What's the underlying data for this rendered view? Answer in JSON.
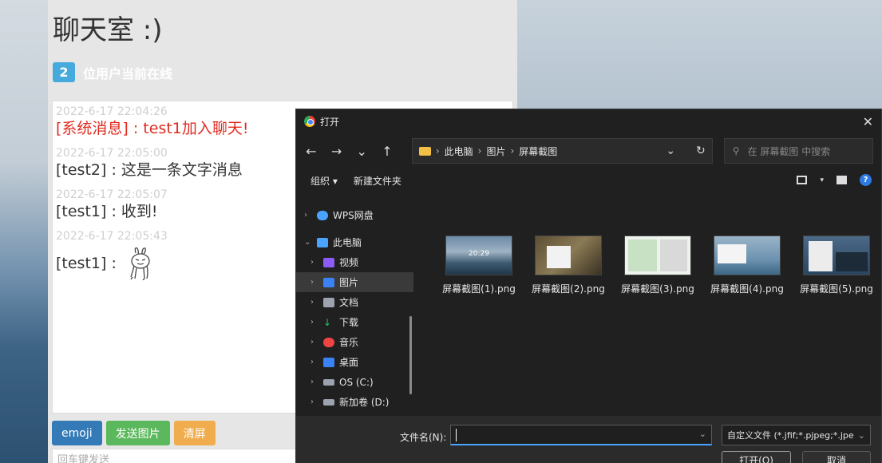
{
  "chat": {
    "title": "聊天室 :)",
    "online_count": "2",
    "online_label": "位用户当前在线",
    "messages": [
      {
        "time": "2022-6-17 22:04:26",
        "text": "[系统消息] : test1加入聊天!"
      },
      {
        "time": "2022-6-17 22:05:00",
        "text": "[test2] : 这是一条文字消息"
      },
      {
        "time": "2022-6-17 22:05:07",
        "text": "[test1] : 收到!"
      },
      {
        "time": "2022-6-17 22:05:43",
        "text": "[test1] :"
      }
    ],
    "buttons": {
      "emoji": "emoji",
      "send_image": "发送图片",
      "clear": "清屏"
    },
    "input_placeholder": "回车键发送",
    "colors": {
      "system": "#e02b20",
      "badge": "#46aadc",
      "emoji_btn": "#337ab7",
      "image_btn": "#5cb85c",
      "clear_btn": "#f0ad4e"
    }
  },
  "dialog": {
    "title": "打开",
    "close": "✕",
    "nav": {
      "back": "←",
      "forward": "→",
      "recent": "⌄",
      "up": "↑"
    },
    "breadcrumb": [
      "此电脑",
      "图片",
      "屏幕截图"
    ],
    "search_placeholder": "在 屏幕截图 中搜索",
    "commands": {
      "organize": "组织 ▾",
      "new_folder": "新建文件夹"
    },
    "nav_items": [
      {
        "label": "WPS网盘",
        "icon": "cloud-icon",
        "color": "#4aa3ff"
      },
      {
        "label": "此电脑",
        "icon": "computer-icon",
        "color": "#4aa3ff"
      },
      {
        "label": "视频",
        "icon": "video-icon",
        "color": "#8b5cf6"
      },
      {
        "label": "图片",
        "icon": "pictures-icon",
        "color": "#3b82f6"
      },
      {
        "label": "文档",
        "icon": "documents-icon",
        "color": "#9ca3af"
      },
      {
        "label": "下载",
        "icon": "download-icon",
        "color": "#22c55e"
      },
      {
        "label": "音乐",
        "icon": "music-icon",
        "color": "#ef4444"
      },
      {
        "label": "桌面",
        "icon": "desktop-icon",
        "color": "#3b82f6"
      },
      {
        "label": "OS (C:)",
        "icon": "drive-icon",
        "color": "#9ca3af"
      },
      {
        "label": "新加卷 (D:)",
        "icon": "drive-icon",
        "color": "#9ca3af"
      }
    ],
    "files": [
      {
        "name": "屏幕截图(1).png",
        "thumb_time": "20:29"
      },
      {
        "name": "屏幕截图(2).png"
      },
      {
        "name": "屏幕截图(3).png"
      },
      {
        "name": "屏幕截图(4).png"
      },
      {
        "name": "屏幕截图(5).png"
      }
    ],
    "filename_label": "文件名(N):",
    "filename_value": "",
    "file_type": "自定义文件 (*.jfif;*.pjpeg;*.jpe",
    "open_button": "打开(O)",
    "cancel_button": "取消"
  }
}
